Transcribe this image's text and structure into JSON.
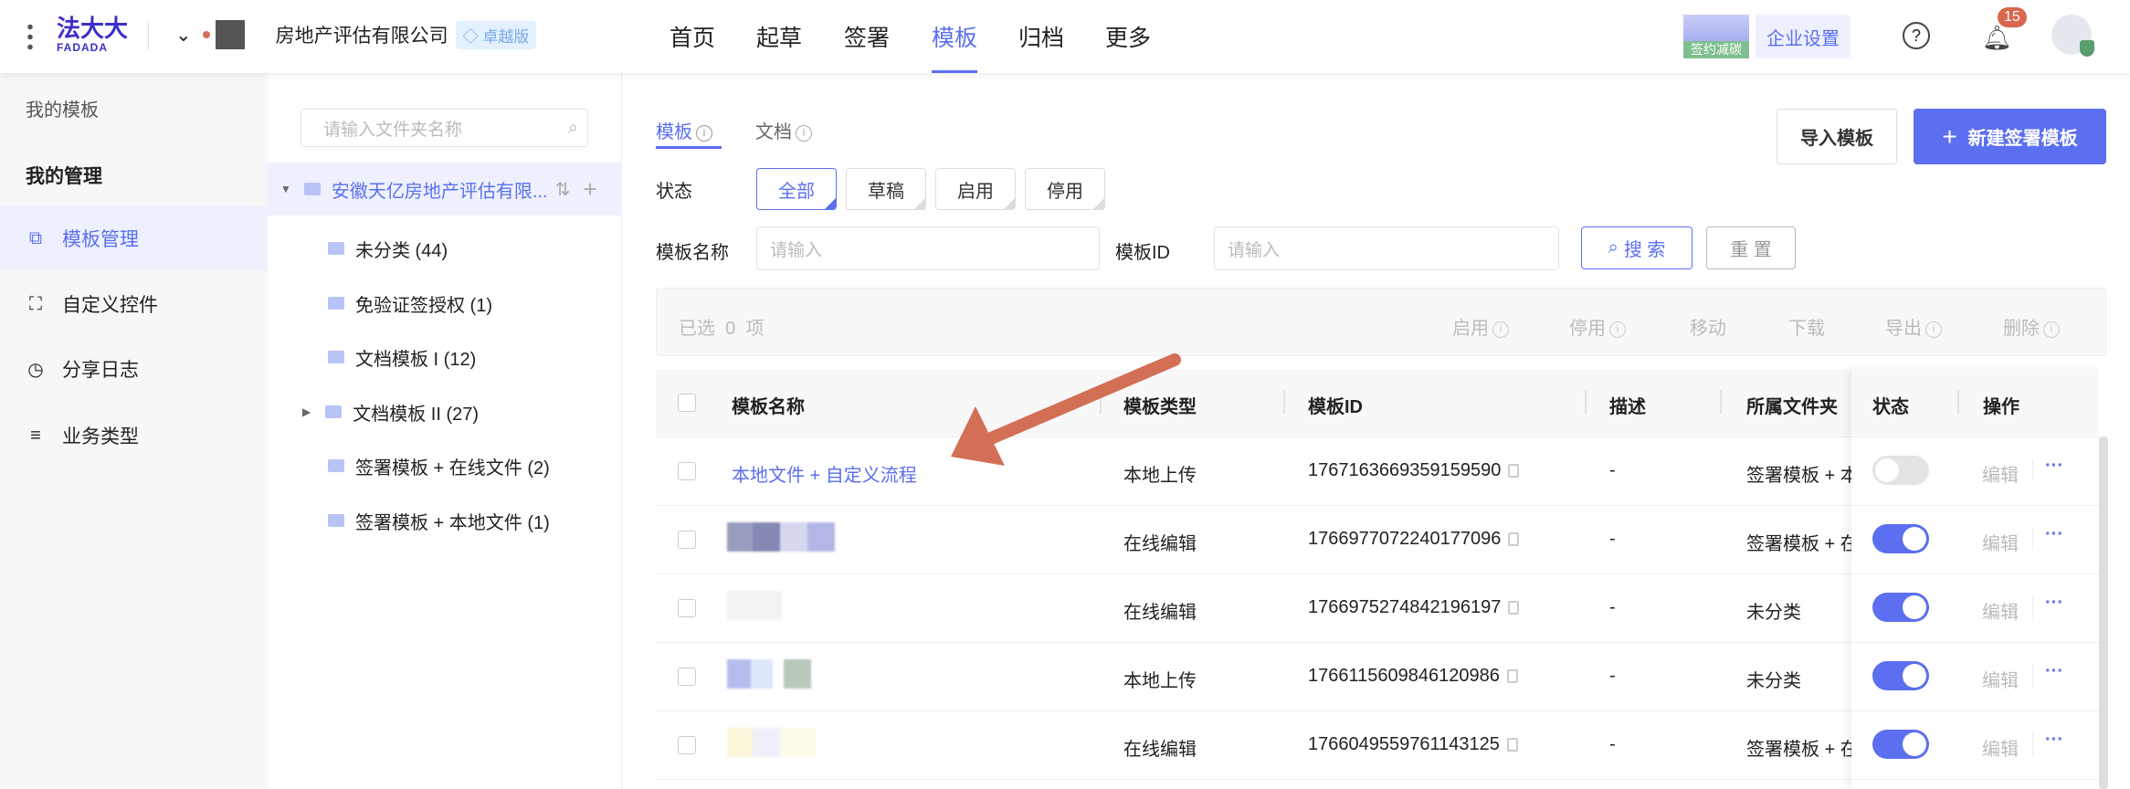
{
  "header": {
    "logo_cn": "法大大",
    "logo_en": "FADADA",
    "company": "房地产评估有限公司",
    "edition": "卓越版",
    "nav": [
      "首页",
      "起草",
      "签署",
      "模板",
      "归档",
      "更多"
    ],
    "active_nav": "模板",
    "banner": "签约减碳",
    "settings": "企业设置",
    "notifications": "15"
  },
  "sidebar": {
    "section1": "我的模板",
    "section2": "我的管理",
    "items": [
      "模板管理",
      "自定义控件",
      "分享日志",
      "业务类型"
    ]
  },
  "folders": {
    "search_placeholder": "请输入文件夹名称",
    "root": "安徽天亿房地产评估有限...",
    "items": [
      "未分类 (44)",
      "免验证签授权 (1)",
      "文档模板 I (12)",
      "文档模板 II (27)",
      "签署模板 + 在线文件 (2)",
      "签署模板 + 本地文件 (1)"
    ]
  },
  "main": {
    "tabs": [
      "模板",
      "文档"
    ],
    "import": "导入模板",
    "create": "新建签署模板",
    "status_label": "状态",
    "status_options": [
      "全部",
      "草稿",
      "启用",
      "停用"
    ],
    "name_label": "模板名称",
    "name_placeholder": "请输入",
    "id_label": "模板ID",
    "id_placeholder": "请输入",
    "search": "搜 索",
    "reset": "重 置",
    "selection": {
      "selected": "已选",
      "count": "0",
      "unit": "项",
      "actions": [
        "启用",
        "停用",
        "移动",
        "下载",
        "导出",
        "删除"
      ]
    },
    "columns": [
      "模板名称",
      "模板类型",
      "模板ID",
      "描述",
      "所属文件夹",
      "状态",
      "操作"
    ],
    "rows": [
      {
        "name": "本地文件 + 自定义流程",
        "type": "本地上传",
        "id": "1767163669359159590",
        "desc": "-",
        "folder": "签署模板 + 本",
        "enabled": false,
        "edit": "编辑",
        "more": "···"
      },
      {
        "name": "",
        "type": "在线编辑",
        "id": "1766977072240177096",
        "desc": "-",
        "folder": "签署模板 + 在",
        "enabled": true,
        "edit": "编辑",
        "more": "···"
      },
      {
        "name": "",
        "type": "在线编辑",
        "id": "1766975274842196197",
        "desc": "-",
        "folder": "未分类",
        "enabled": true,
        "edit": "编辑",
        "more": "···"
      },
      {
        "name": "",
        "type": "本地上传",
        "id": "1766115609846120986",
        "desc": "-",
        "folder": "未分类",
        "enabled": true,
        "edit": "编辑",
        "more": "···"
      },
      {
        "name": "",
        "type": "在线编辑",
        "id": "1766049559761143125",
        "desc": "-",
        "folder": "签署模板 + 在",
        "enabled": true,
        "edit": "编辑",
        "more": "···"
      }
    ]
  },
  "colors": {
    "accent": "#5b6ff0",
    "arrow": "#d36f55",
    "badge": "#d9674e"
  }
}
